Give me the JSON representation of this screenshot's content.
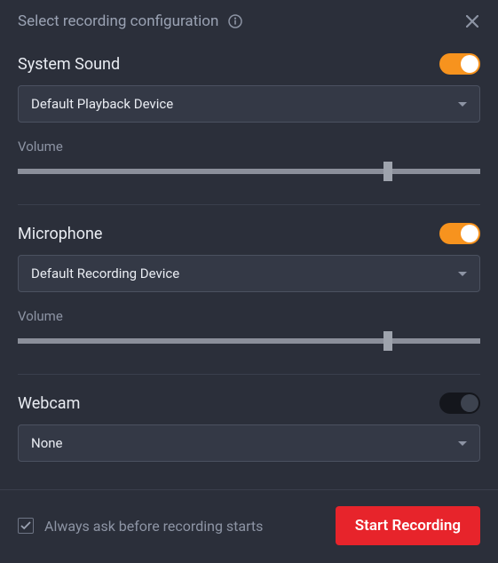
{
  "header": {
    "title": "Select recording configuration"
  },
  "system_sound": {
    "title": "System Sound",
    "toggle": true,
    "device": "Default Playback Device",
    "volume_label": "Volume",
    "volume": 80
  },
  "microphone": {
    "title": "Microphone",
    "toggle": true,
    "device": "Default Recording Device",
    "volume_label": "Volume",
    "volume": 80
  },
  "webcam": {
    "title": "Webcam",
    "toggle": false,
    "device": "None"
  },
  "footer": {
    "always_ask_checked": true,
    "always_ask_label": "Always ask before recording starts",
    "start_label": "Start Recording"
  }
}
